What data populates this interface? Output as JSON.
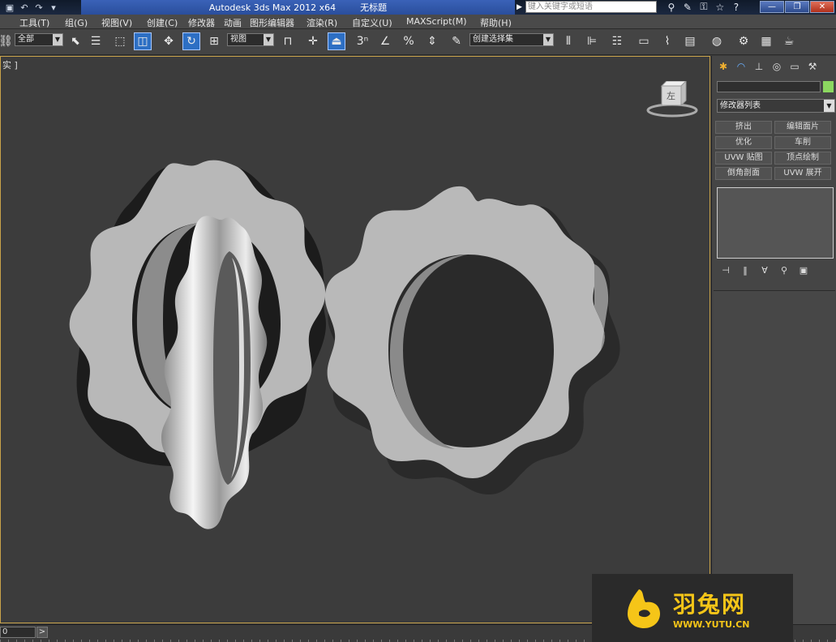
{
  "titlebar": {
    "app_title": "Autodesk 3ds Max  2012 x64",
    "doc_title": "无标题",
    "search_placeholder": "键入关键字或短语",
    "quick_access_icons": [
      "save-icon",
      "undo-icon",
      "redo-icon",
      "dropdown-icon"
    ],
    "tool_icons": [
      "binoculars-icon",
      "wrench-icon",
      "key-icon",
      "star-icon",
      "help-icon"
    ],
    "window_buttons": [
      "minimize",
      "restore",
      "close"
    ]
  },
  "menu": {
    "items": [
      "工具(T)",
      "组(G)",
      "视图(V)",
      "创建(C)",
      "修改器",
      "动画",
      "图形编辑器",
      "渲染(R)",
      "自定义(U)",
      "MAXScript(M)",
      "帮助(H)"
    ]
  },
  "toolbar": {
    "selection_filter": "全部",
    "reference_coord": "视图",
    "snap_label": "3",
    "named_selection": "创建选择集",
    "accent_color": "#2d6fc4"
  },
  "viewport": {
    "label": "实 ]",
    "viewcube_face": "左",
    "border_color": "#c8a24a"
  },
  "command_panel": {
    "tab_icons": [
      "create-icon",
      "modify-icon",
      "hierarchy-icon",
      "motion-icon",
      "display-icon",
      "utilities-icon"
    ],
    "modifier_list_label": "修改器列表",
    "modifier_buttons": [
      [
        "挤出",
        "编辑面片"
      ],
      [
        "优化",
        "车削"
      ],
      [
        "UVW 贴图",
        "顶点绘制"
      ],
      [
        "倒角剖面",
        "UVW 展开"
      ]
    ],
    "object_color": "#8cd860"
  },
  "timeline": {
    "frame_value": "0",
    "next_label": ">"
  },
  "watermark": {
    "brand": "羽兔网",
    "url": "WWW.YUTU.CN",
    "color": "#f5c518"
  }
}
